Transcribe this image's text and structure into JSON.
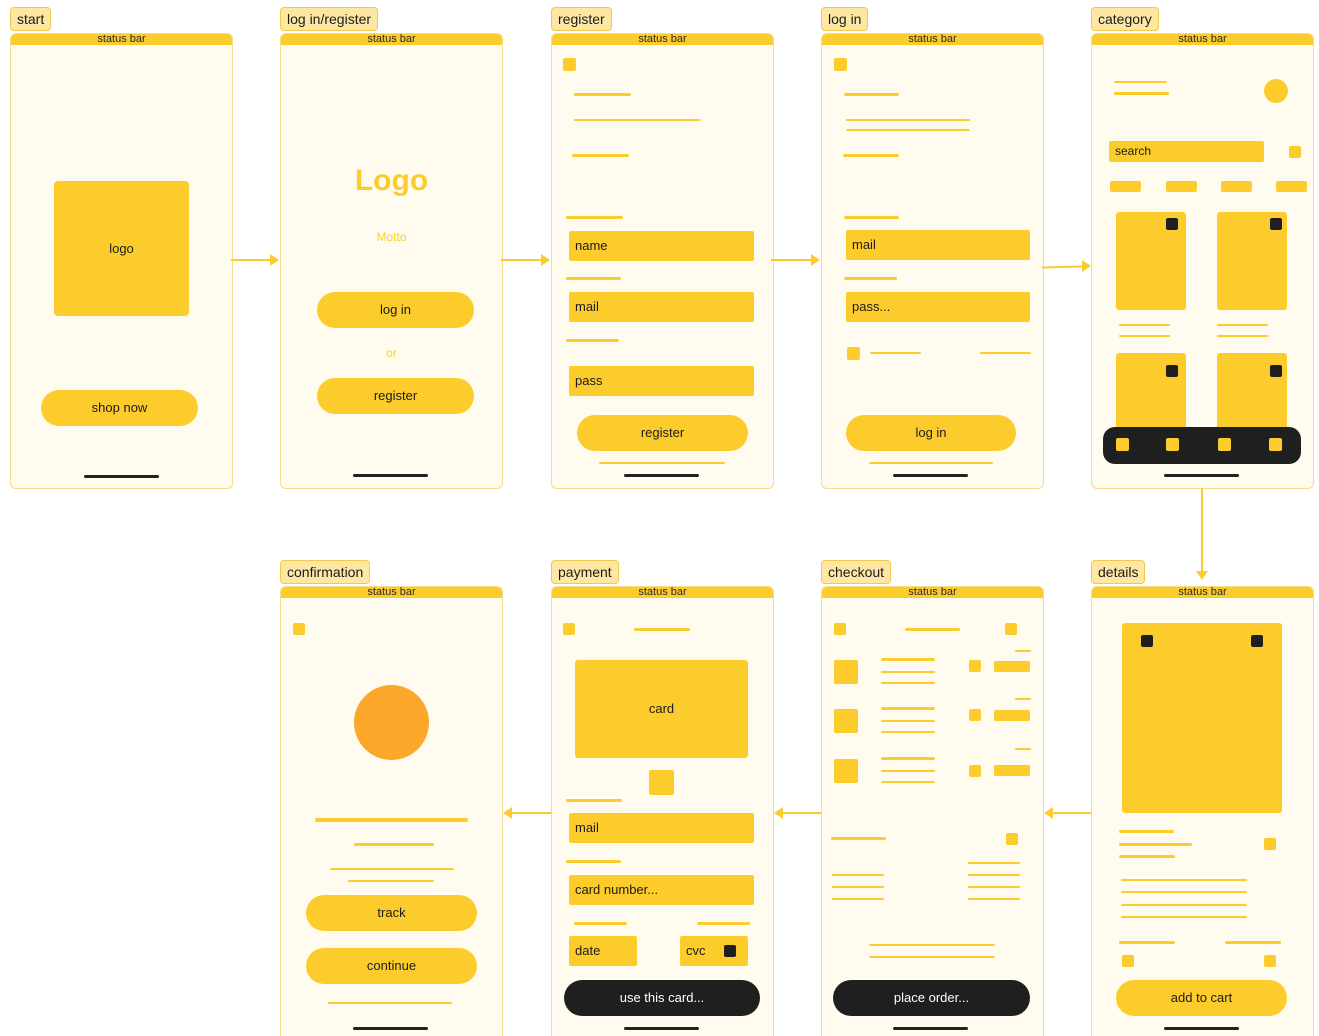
{
  "colors": {
    "accent": "#fccc2d",
    "frame_bg": "#fffcef",
    "dark": "#1f1f1f",
    "success": "#fca72a"
  },
  "screens": {
    "start": {
      "tag": "start",
      "status": "status bar",
      "logo": "logo",
      "shop_now": "shop now"
    },
    "login_register": {
      "tag": "log in/register",
      "status": "status bar",
      "logo": "Logo",
      "motto": "Motto",
      "login": "log in",
      "or": "or",
      "register": "register"
    },
    "register": {
      "tag": "register",
      "status": "status bar",
      "name": "name",
      "mail": "mail",
      "pass": "pass",
      "register_btn": "register"
    },
    "login": {
      "tag": "log in",
      "status": "status bar",
      "mail": "mail",
      "pass": "pass...",
      "login_btn": "log in"
    },
    "category": {
      "tag": "category",
      "status": "status bar",
      "search": "search"
    },
    "details": {
      "tag": "details",
      "status": "status bar",
      "add_to_cart": "add to cart"
    },
    "checkout": {
      "tag": "checkout",
      "status": "status bar",
      "place_order": "place order..."
    },
    "payment": {
      "tag": "payment",
      "status": "status bar",
      "card": "card",
      "mail": "mail",
      "card_number": "card number...",
      "date": "date",
      "cvc": "cvc",
      "use_card": "use this card..."
    },
    "confirmation": {
      "tag": "confirmation",
      "status": "status bar",
      "track": "track",
      "continue": "continue"
    }
  }
}
